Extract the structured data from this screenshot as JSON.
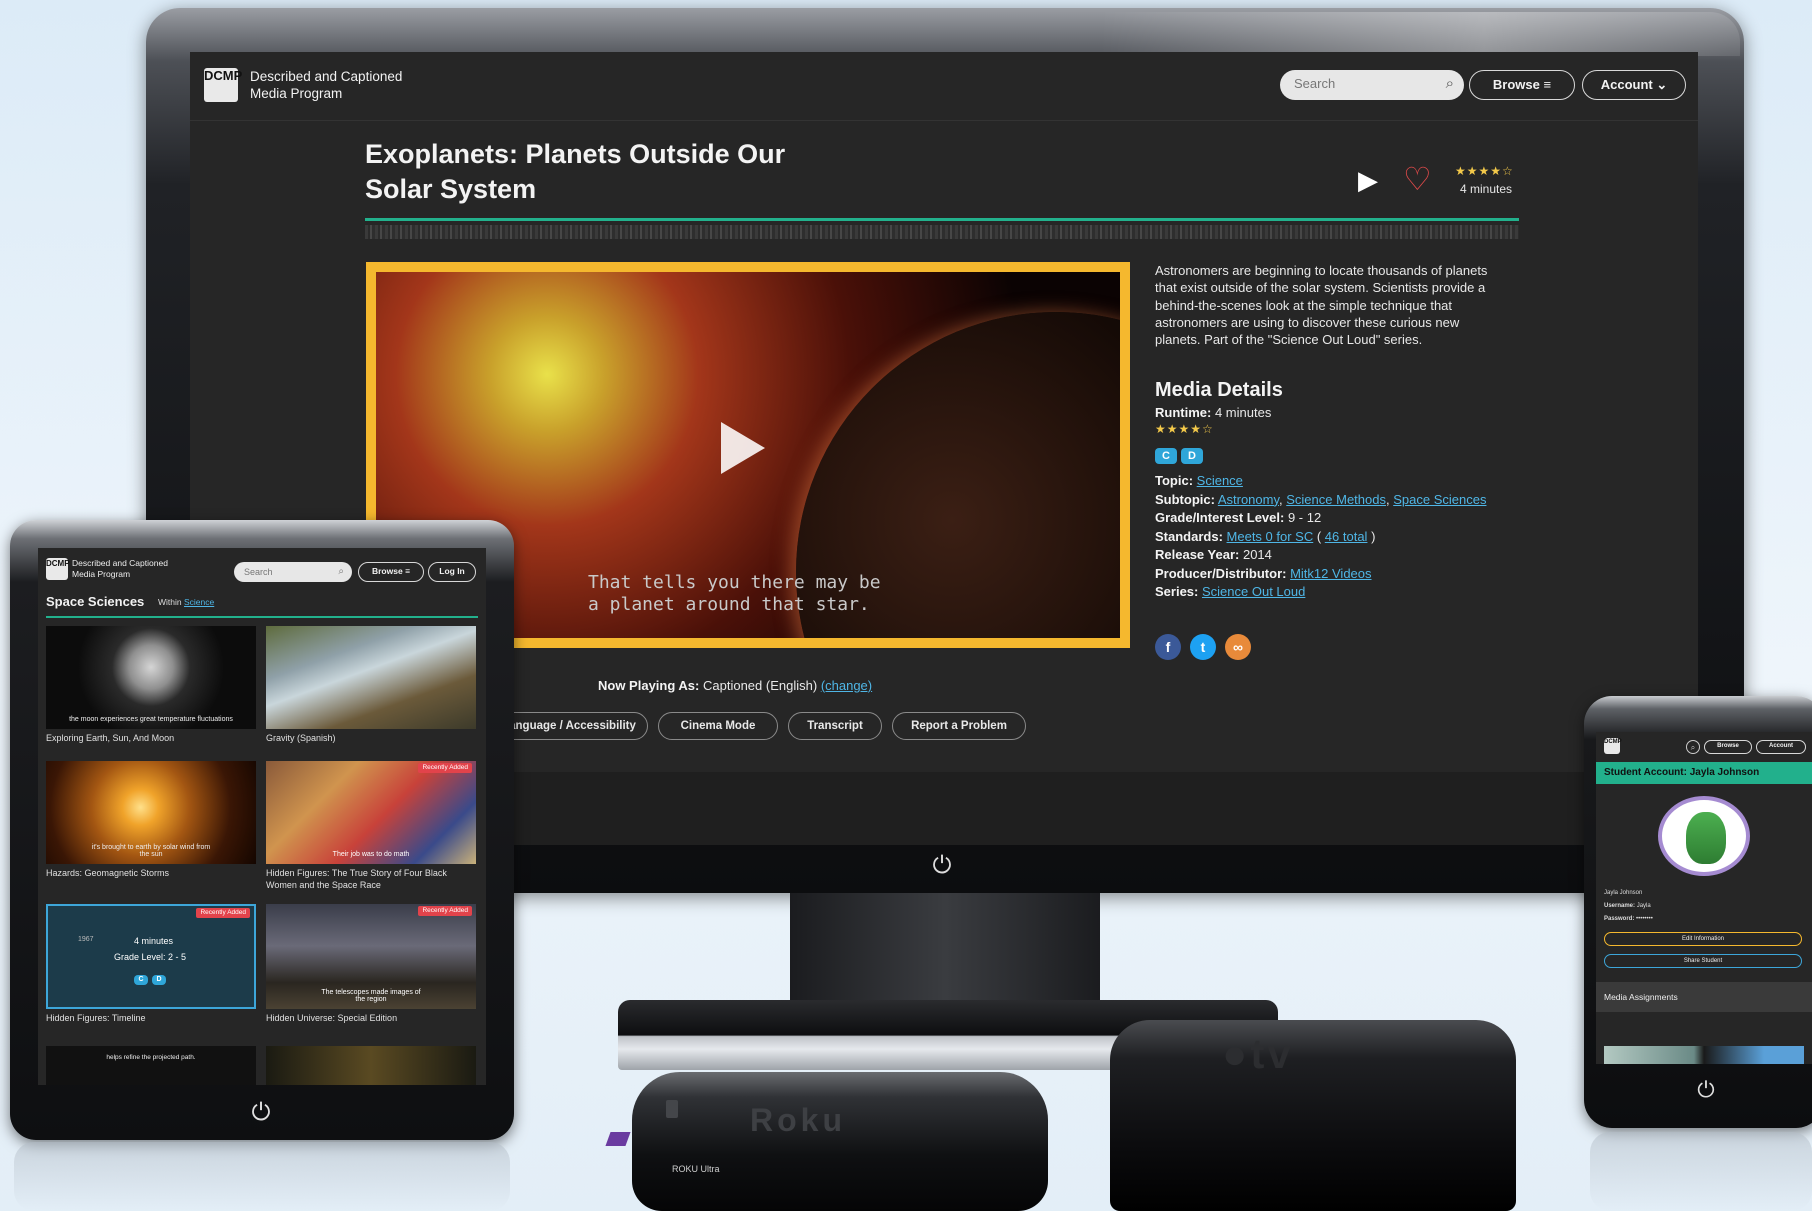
{
  "site": {
    "logo_mark": "DCMP",
    "logo_line1": "Described and Captioned",
    "logo_line2": "Media Program",
    "search_placeholder": "Search",
    "browse_label": "Browse",
    "account_label": "Account",
    "login_label": "Log In"
  },
  "monitor": {
    "title_line1": "Exoplanets: Planets Outside Our",
    "title_line2": "Solar System",
    "rating_stars": "★★★★☆",
    "rating_value": 4,
    "duration": "4 minutes",
    "subtitle_line1": "That tells you there may be",
    "subtitle_line2": "a planet around that star.",
    "description": "Astronomers are beginning to locate thousands of planets that exist outside of the solar system. Scientists provide a behind-the-scenes look at the simple technique that astronomers are using to discover these curious new planets. Part of the \"Science Out Loud\" series.",
    "details_heading": "Media Details",
    "runtime_label": "Runtime:",
    "runtime_value": "4 minutes",
    "badge_c": "C",
    "badge_d": "D",
    "topic_label": "Topic:",
    "topic_value": "Science",
    "subtopic_label": "Subtopic:",
    "subtopic_1": "Astronomy",
    "subtopic_2": "Science Methods",
    "subtopic_3": "Space Sciences",
    "grade_label": "Grade/Interest Level:",
    "grade_value": "9 - 12",
    "standards_label": "Standards:",
    "standards_link": "Meets 0 for SC",
    "standards_total": "46 total",
    "release_label": "Release Year:",
    "release_value": "2014",
    "producer_label": "Producer/Distributor:",
    "producer_value": "Mitk12 Videos",
    "series_label": "Series:",
    "series_value": "Science Out Loud",
    "now_playing_label": "Now Playing As:",
    "now_playing_value": "Captioned (English)",
    "change_link": "(change)",
    "btn_language": "Language / Accessibility",
    "btn_cinema": "Cinema Mode",
    "btn_transcript": "Transcript",
    "btn_report": "Report a Problem"
  },
  "tablet": {
    "heading": "Space Sciences",
    "within_label": "Within",
    "within_link": "Science",
    "recently_added": "Recently Added",
    "items": [
      {
        "title": "Exploring Earth, Sun, And Moon",
        "overlay": "the moon experiences great temperature fluctuations"
      },
      {
        "title": "Gravity (Spanish)",
        "overlay": ""
      },
      {
        "title": "Hazards: Geomagnetic Storms",
        "overlay": "it's brought to earth by solar wind from the sun"
      },
      {
        "title": "Hidden Figures: The True Story of Four Black Women and the Space Race",
        "overlay": "Their job was to do math"
      },
      {
        "title": "Hidden Figures: Timeline",
        "overlay": ""
      },
      {
        "title": "Hidden Universe: Special Edition",
        "overlay": "The telescopes made images of the region"
      }
    ],
    "hover_minutes": "4 minutes",
    "hover_grade": "Grade Level: 2 - 5",
    "hover_year": "1967",
    "bottom_overlay": "helps refine the projected path."
  },
  "phone": {
    "account_title": "Student Account: Jayla Johnson",
    "name": "Jayla Johnson",
    "username_label": "Username:",
    "username_value": "Jayla",
    "password_label": "Password:",
    "password_value": "••••••••",
    "edit_btn": "Edit Information",
    "share_btn": "Share Student",
    "assignments": "Media Assignments"
  },
  "devices": {
    "roku_brand": "Roku",
    "roku_label": "ROKU Ultra",
    "appletv_brand": "tv"
  },
  "colors": {
    "accent_teal": "#22b08c",
    "video_border": "#f5b82e",
    "link_blue": "#4fb6e6",
    "recently_added_red": "#e2434b"
  }
}
